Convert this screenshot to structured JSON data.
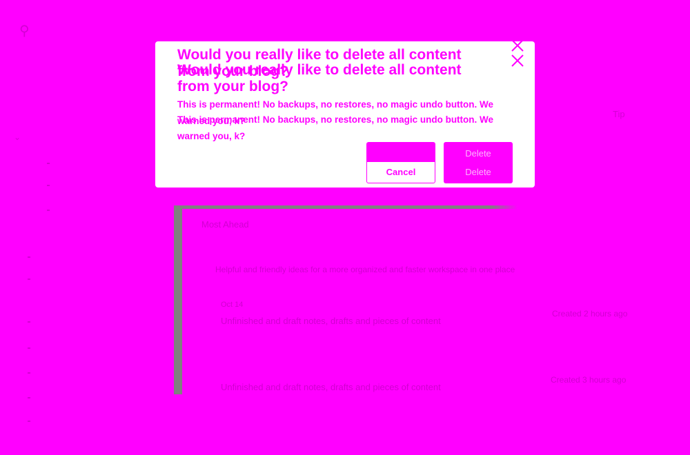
{
  "dialog": {
    "title": "Would you really like to delete all content from your blog?",
    "body": "This is permanent! No backups, no restores, no magic undo button. We warned you, k?",
    "cancel_label": "Cancel",
    "delete_label": "Delete"
  },
  "background": {
    "card_header": "Most Ahead",
    "card_row_1": "Helpful and friendly ideas for a more organized and faster workspace in one place",
    "card_row_2_sub": "Oct 14",
    "card_row_2": "Unfinished and draft notes, drafts and pieces of content",
    "card_row_2_meta": "Created 2 hours ago",
    "card_row_3": "Unfinished and draft notes, drafts and pieces of content",
    "card_row_3_meta": "Created 3 hours ago",
    "header_right": "Tip"
  },
  "colors": {
    "backdrop": "#ff00ff",
    "dialog": "#ffffff",
    "accent": "#ff00ff",
    "card_bar": "#808080"
  }
}
